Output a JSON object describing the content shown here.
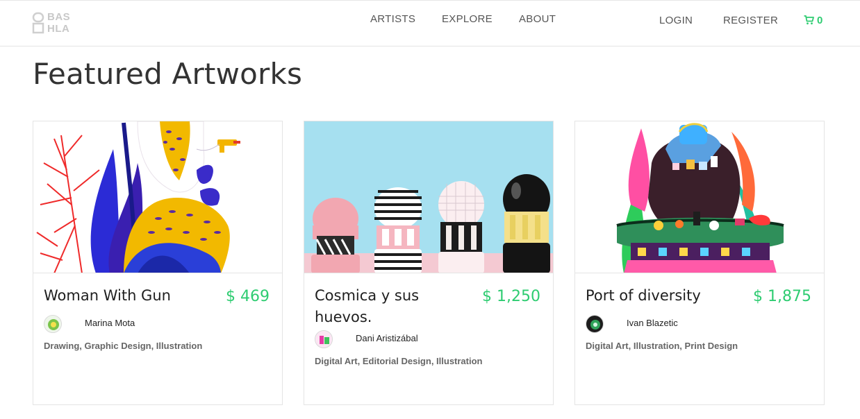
{
  "brand": {
    "logo_line1": "BAS",
    "logo_line2": "HLA"
  },
  "nav": {
    "artists": "ARTISTS",
    "explore": "EXPLORE",
    "about": "ABOUT",
    "login": "LOGIN",
    "register": "REGISTER",
    "cart_count": "0"
  },
  "page": {
    "title": "Featured Artworks"
  },
  "colors": {
    "accent": "#2ecc71",
    "text": "#222222",
    "border": "#e4e4e4"
  },
  "artworks": [
    {
      "title": "Woman With Gun",
      "price": "$ 469",
      "artist": "Marina Mota",
      "tags": "Drawing, Graphic Design, Illustration"
    },
    {
      "title": "Cosmica y sus huevos.",
      "price": "$ 1,250",
      "artist": "Dani Aristizábal",
      "tags": "Digital Art, Editorial Design, Illustration"
    },
    {
      "title": "Port of diversity",
      "price": "$ 1,875",
      "artist": "Ivan Blazetic",
      "tags": "Digital Art, Illustration, Print Design"
    }
  ]
}
